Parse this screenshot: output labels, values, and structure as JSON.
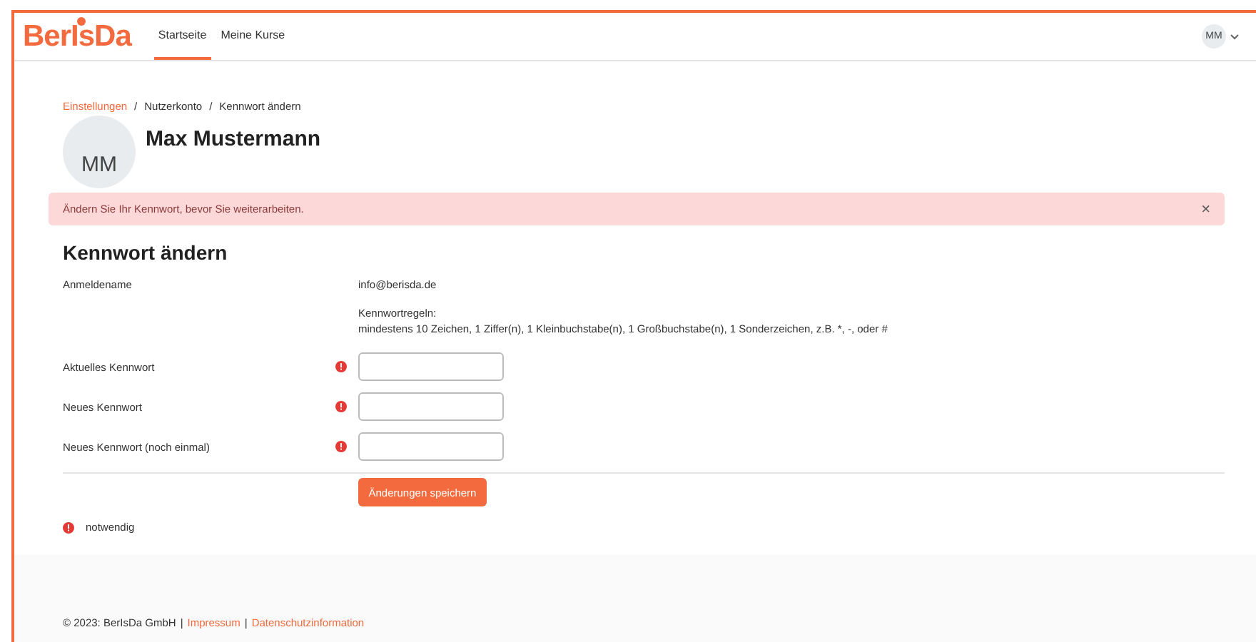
{
  "header": {
    "logo": "BerIsDa",
    "nav": [
      {
        "label": "Startseite",
        "selected": true
      },
      {
        "label": "Meine Kurse",
        "selected": false
      }
    ],
    "user_initials": "MM"
  },
  "breadcrumb": [
    {
      "label": "Einstellungen",
      "kind": "link"
    },
    {
      "label": "Nutzerkonto",
      "kind": "text"
    },
    {
      "label": "Kennwort ändern",
      "kind": "text"
    }
  ],
  "breadcrumb_separator": "/",
  "profile": {
    "initials": "MM",
    "name": "Max Mustermann"
  },
  "alert": {
    "message": "Ändern Sie Ihr Kennwort, bevor Sie weiterarbeiten.",
    "close": "×"
  },
  "form": {
    "title": "Kennwort ändern",
    "rows": [
      {
        "kind": "static",
        "label": "Anmeldename",
        "value": "info@berisda.de"
      },
      {
        "kind": "rules",
        "title": "Kennwortregeln:",
        "text": "mindestens 10 Zeichen, 1 Ziffer(n), 1 Kleinbuchstabe(n), 1 Großbuchstabe(n), 1 Sonderzeichen, z.B. *, -, oder #"
      },
      {
        "kind": "password",
        "label": "Aktuelles Kennwort",
        "required": true
      },
      {
        "kind": "password",
        "label": "Neues Kennwort",
        "required": true
      },
      {
        "kind": "password",
        "label": "Neues Kennwort (noch einmal)",
        "required": true
      }
    ],
    "submit": "Änderungen speichern",
    "required_note": "notwendig"
  },
  "footer": {
    "copyright": "© 2023: BerIsDa GmbH",
    "separator": "|",
    "links": [
      "Impressum",
      "Datenschutzinformation"
    ]
  }
}
